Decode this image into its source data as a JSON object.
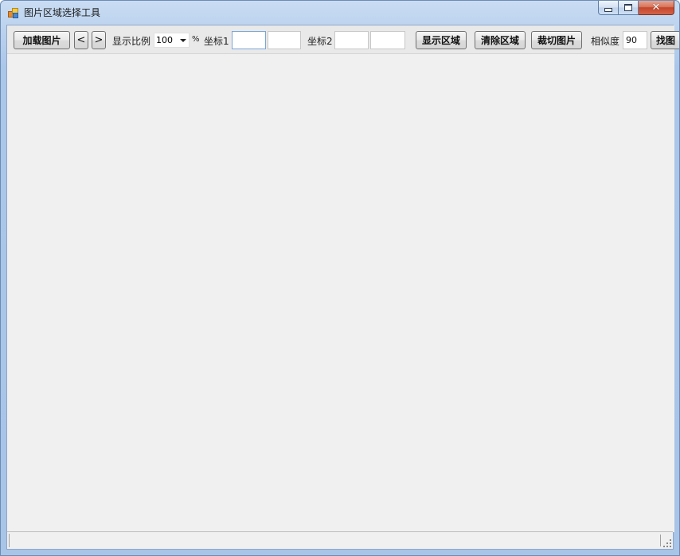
{
  "window": {
    "title": "图片区域选择工具",
    "controls": {
      "minimize": "minimize",
      "maximize": "maximize",
      "close": "✕"
    }
  },
  "toolbar": {
    "load_image": "加载图片",
    "prev": "<",
    "next": ">",
    "scale_label": "显示比例",
    "scale_value": "100",
    "percent": "%",
    "coord1_label": "坐标1",
    "coord1_x": "",
    "coord1_y": "",
    "coord2_label": "坐标2",
    "coord2_x": "",
    "coord2_y": "",
    "show_region": "显示区域",
    "clear_region": "清除区域",
    "crop_image": "裁切图片",
    "similarity_label": "相似度",
    "similarity_value": "90",
    "find_image": "找图"
  },
  "statusbar": {
    "text": ""
  },
  "colors": {
    "frame": "#a8c4e7",
    "client_bg": "#f0f0f0",
    "close_button": "#c4462a"
  }
}
